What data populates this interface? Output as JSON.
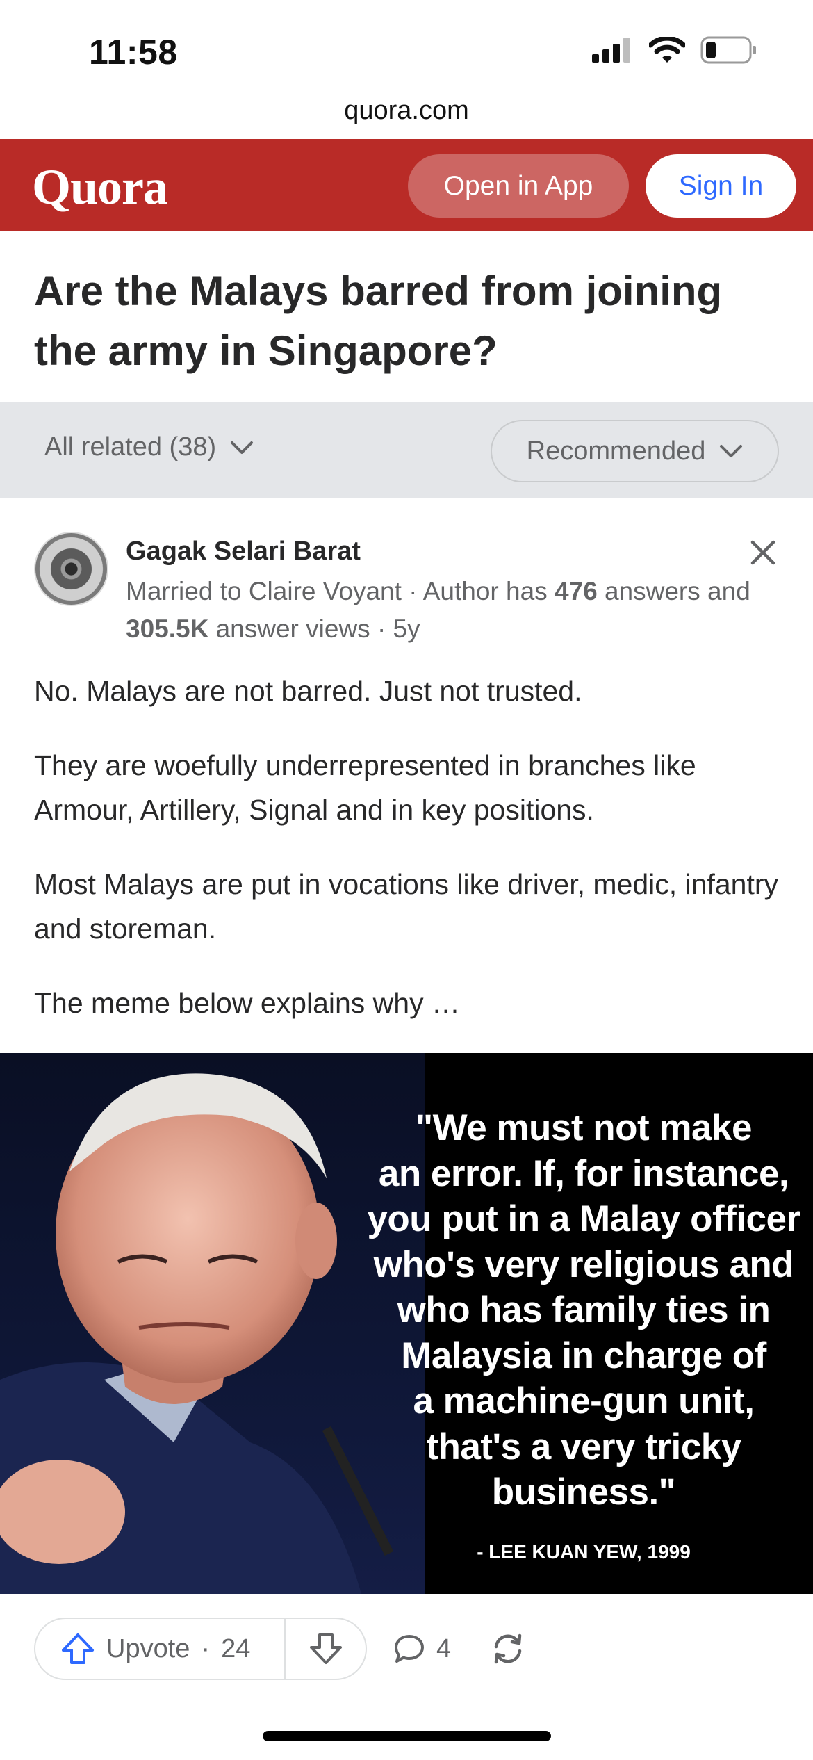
{
  "status_bar": {
    "time": "11:58"
  },
  "browser": {
    "domain": "quora.com"
  },
  "header": {
    "logo": "Quora",
    "open_in_app": "Open in App",
    "sign_in": "Sign In",
    "colors": {
      "brand": "#b92b27",
      "link": "#2e69ff"
    }
  },
  "question": {
    "title": "Are the Malays barred from joining the army in Singapore?"
  },
  "filters": {
    "all_related": "All related (38)",
    "sort": "Recommended"
  },
  "answer": {
    "author_name": "Gagak Selari Barat",
    "credential_prefix": "Married to Claire Voyant · Author has ",
    "answers_count": "476",
    "credential_mid": " answers and ",
    "views_count": "305.5K",
    "credential_suffix": " answer views · 5y",
    "paragraphs": [
      "No. Malays are not barred. Just not trusted.",
      "They are woefully underrepresented in branches like Armour, Artillery, Signal and in key positions.",
      "Most Malays are put in vocations like driver, medic, infantry and storeman.",
      "The meme below explains why …"
    ],
    "meme": {
      "quote_lines": [
        "\"We must not make",
        "an error. If, for instance,",
        "you put in a Malay officer",
        "who's very religious and",
        "who has family ties in",
        "Malaysia in charge of",
        "a machine-gun unit,",
        "that's a very tricky",
        "business.\""
      ],
      "attribution": "- LEE KUAN YEW, 1999"
    }
  },
  "actions": {
    "upvote_label": "Upvote",
    "upvote_count": "24",
    "separator": "·",
    "comment_count": "4",
    "icons": [
      "upvote-arrow-icon",
      "downvote-arrow-icon",
      "comment-bubble-icon",
      "share-reload-icon"
    ]
  }
}
